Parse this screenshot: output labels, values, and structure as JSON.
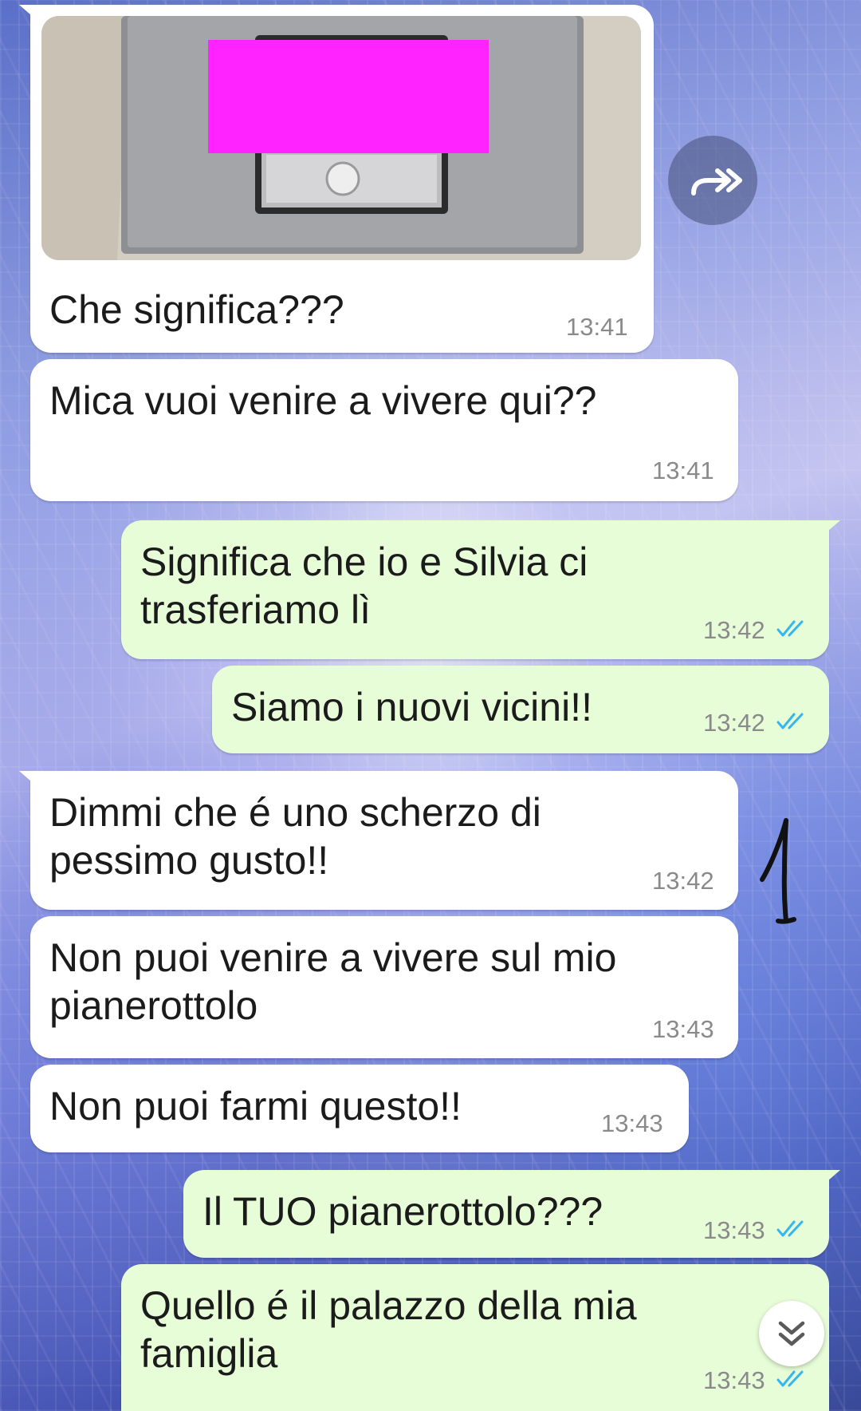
{
  "messages": [
    {
      "id": "m1",
      "dir": "in",
      "text": "Che significa???",
      "time": "13:41",
      "has_photo": true
    },
    {
      "id": "m2",
      "dir": "in",
      "text": "Mica vuoi venire a vivere qui??",
      "time": "13:41"
    },
    {
      "id": "m3",
      "dir": "out",
      "text": "Significa che io e Silvia ci\ntrasferiamo lì",
      "time": "13:42",
      "status": "read"
    },
    {
      "id": "m4",
      "dir": "out",
      "text": "Siamo i nuovi vicini!!",
      "time": "13:42",
      "status": "read"
    },
    {
      "id": "m5",
      "dir": "in",
      "text": "Dimmi che é uno scherzo di\npessimo gusto!!",
      "time": "13:42"
    },
    {
      "id": "m6",
      "dir": "in",
      "text": "Non puoi venire a vivere sul mio\npianerottolo",
      "time": "13:43"
    },
    {
      "id": "m7",
      "dir": "in",
      "text": "Non puoi farmi questo!!",
      "time": "13:43"
    },
    {
      "id": "m8",
      "dir": "out",
      "text": "Il TUO pianerottolo???",
      "time": "13:43",
      "status": "read"
    },
    {
      "id": "m9",
      "dir": "out",
      "text": "Quello é il palazzo della mia\nfamiglia",
      "time": "13:43",
      "status": "read"
    }
  ],
  "annotation": {
    "handwritten_mark": "1"
  },
  "icons": {
    "forward": "forward-arrow-icon",
    "scroll_down": "double-chevron-down-icon",
    "read_receipt": "double-check-icon"
  },
  "colors": {
    "incoming_bubble": "#ffffff",
    "outgoing_bubble": "#e7fdd8",
    "read_tick": "#34b7f1",
    "timestamp": "#8a8a8a",
    "redaction": "#ff24ff"
  }
}
